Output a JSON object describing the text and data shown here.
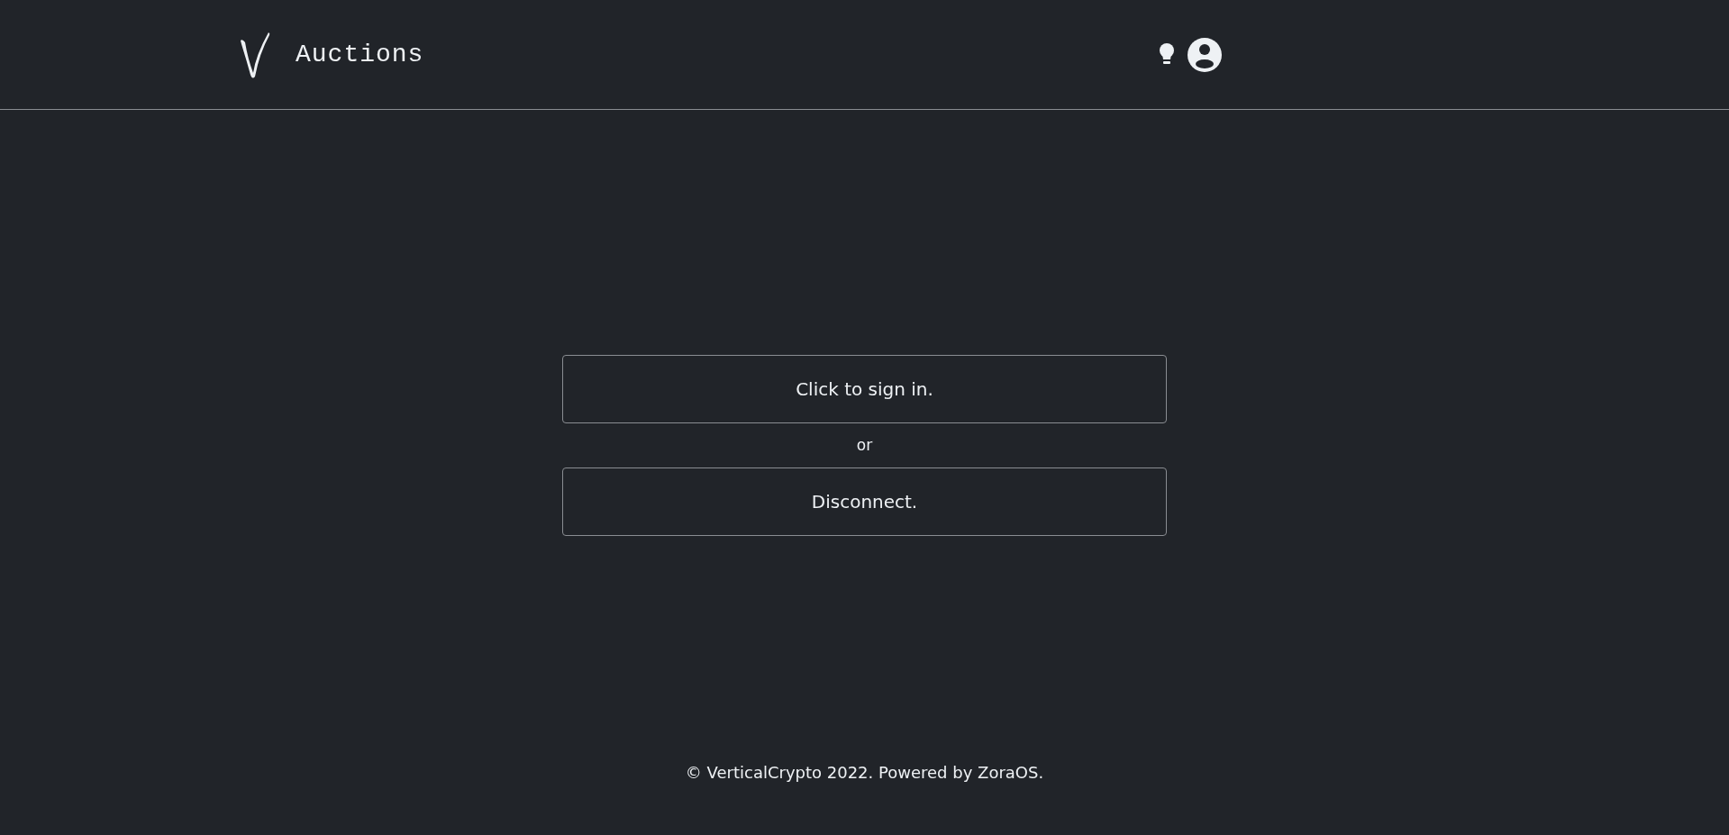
{
  "header": {
    "title": "Auctions"
  },
  "actions": [
    {
      "kind": "button",
      "label": "Click to sign in."
    },
    {
      "kind": "separator",
      "label": "or"
    },
    {
      "kind": "button",
      "label": "Disconnect."
    }
  ],
  "footer": {
    "text": "© VerticalCrypto 2022. Powered by ZoraOS."
  }
}
